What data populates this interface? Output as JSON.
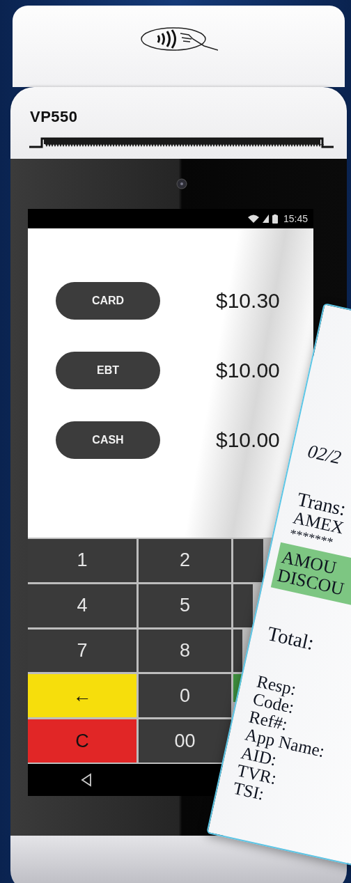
{
  "device": {
    "model": "VP550"
  },
  "status_bar": {
    "time": "15:45"
  },
  "payment_options": [
    {
      "label": "CARD",
      "amount": "$10.30"
    },
    {
      "label": "EBT",
      "amount": "$10.00"
    },
    {
      "label": "CASH",
      "amount": "$10.00"
    }
  ],
  "keypad": [
    {
      "kind": "digit",
      "label": "1"
    },
    {
      "kind": "digit",
      "label": "2"
    },
    {
      "kind": "digit"
    },
    {
      "kind": "digit",
      "label": "4"
    },
    {
      "kind": "digit",
      "label": "5"
    },
    {
      "kind": "digit"
    },
    {
      "kind": "digit",
      "label": "7"
    },
    {
      "kind": "digit",
      "label": "8"
    },
    {
      "kind": "digit"
    },
    {
      "kind": "back",
      "label": "←"
    },
    {
      "kind": "digit",
      "label": "0"
    },
    {
      "kind": "enter"
    },
    {
      "kind": "clear",
      "label": "C"
    },
    {
      "kind": "digit",
      "label": "00"
    }
  ],
  "receipt": {
    "date": "02/2",
    "card_lines": [
      "Trans:",
      "AMEX",
      "*******"
    ],
    "highlight_lines": [
      "AMOU",
      "DISCOU"
    ],
    "total": "Total:",
    "detail_lines": [
      "Resp:",
      "Code:",
      "Ref#:",
      "App Name:",
      "AID:",
      "TVR:",
      "TSI:"
    ]
  }
}
